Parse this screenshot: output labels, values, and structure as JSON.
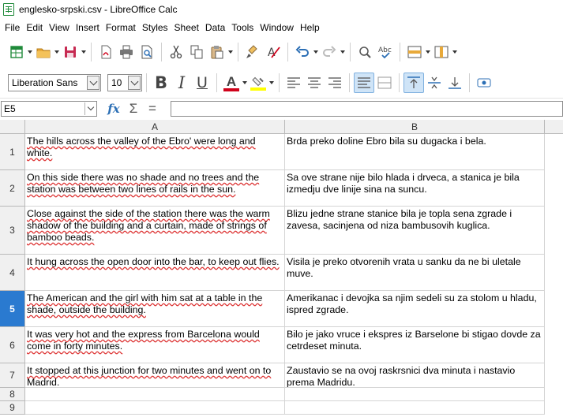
{
  "window": {
    "title": "englesko-srpski.csv - LibreOffice Calc"
  },
  "menu": [
    "File",
    "Edit",
    "View",
    "Insert",
    "Format",
    "Styles",
    "Sheet",
    "Data",
    "Tools",
    "Window",
    "Help"
  ],
  "toolbar": {
    "font_name": "Liberation Sans",
    "font_size": "10",
    "bold_label": "B",
    "italic_label": "I",
    "underline_label": "U",
    "font_color_label": "A"
  },
  "colors": {
    "font_color": "#d0021b",
    "highlight_color": "#ffff00",
    "selected_row": "#2a7ad0"
  },
  "formula_bar": {
    "name_box": "E5",
    "fx": "fx",
    "sum": "Σ",
    "equals": "=",
    "content": ""
  },
  "columns": [
    "A",
    "B"
  ],
  "rows": [
    {
      "n": "1",
      "a": "The hills across the valley of the Ebro' were long and white.",
      "b": "Brda preko doline Ebro bila su dugacka i bela."
    },
    {
      "n": "2",
      "a": "On this side there was no shade and no trees and the station was between two lines of rails in the sun.",
      "b": "Sa ove strane nije bilo hlada i drveca, a stanica je bila izmedju dve linije sina na suncu."
    },
    {
      "n": "3",
      "a": "Close against the side of the station there was the warm shadow of the building and a curtain, made of strings of bamboo beads.",
      "b": "Blizu jedne strane stanice bila je topla sena zgrade i zavesa, sacinjena od niza bambusovih kuglica."
    },
    {
      "n": "4",
      "a": "It hung across the open door into the bar, to keep out flies.",
      "b": "Visila je preko otvorenih vrata u sanku da ne bi uletale muve."
    },
    {
      "n": "5",
      "a": "The American and the girl with him sat at a table in the shade, outside the building.",
      "b": "Amerikanac i devojka sa njim sedeli su za stolom u hladu, ispred zgrade."
    },
    {
      "n": "6",
      "a": "It was very hot and the express from Barcelona would come in forty minutes.",
      "b": "Bilo je jako vruce i ekspres iz Barselone bi stigao dovde za cetrdeset minuta."
    },
    {
      "n": "7",
      "a": "It stopped at this junction for two minutes and went on to Madrid.",
      "b": "Zaustavio se na ovoj raskrsnici dva minuta i nastavio prema Madridu."
    },
    {
      "n": "8",
      "a": "",
      "b": ""
    },
    {
      "n": "9",
      "a": "",
      "b": ""
    }
  ]
}
